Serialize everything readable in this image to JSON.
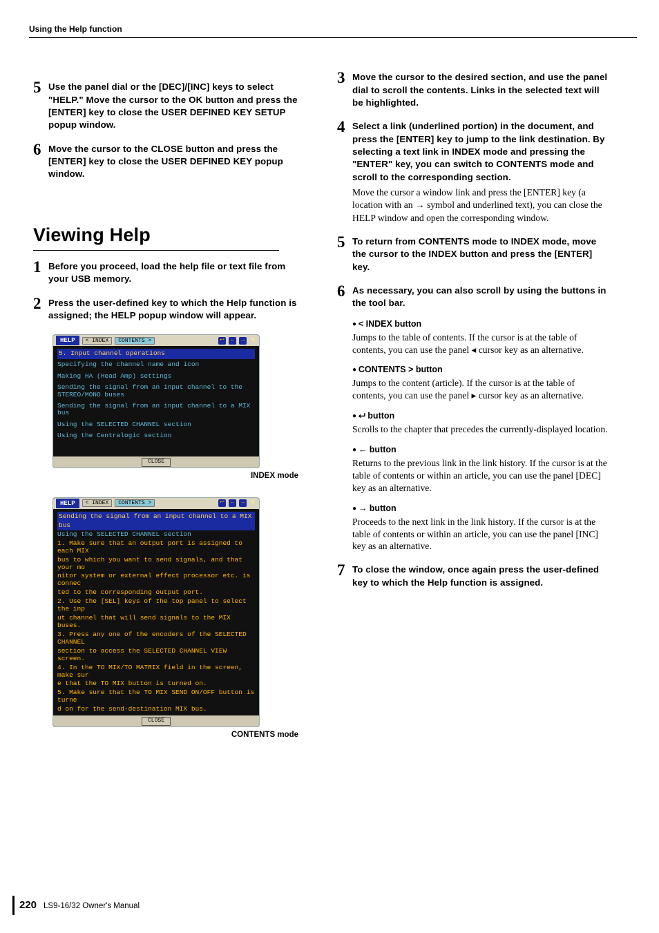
{
  "header": {
    "running": "Using the Help function"
  },
  "left": {
    "step5": "Use the panel dial or the [DEC]/[INC] keys to select \"HELP.\" Move the cursor to the OK button and press the [ENTER] key to close the USER DEFINED KEY SETUP popup window.",
    "step6": "Move the cursor to the CLOSE button and press the [ENTER] key to close the USER DEFINED KEY popup window.",
    "section_title": "Viewing Help",
    "vh1": "Before you proceed, load the help file or text file from your USB memory.",
    "vh2": "Press the user-defined key to which the Help function is assigned; the HELP popup window will appear.",
    "caption1": "INDEX mode",
    "caption2": "CONTENTS mode",
    "ss1": {
      "title": "HELP",
      "btn_index": "< INDEX",
      "btn_contents": "CONTENTS >",
      "hl": "5. Input channel operations",
      "lines": [
        "Specifying the channel name and icon",
        "Making HA (Head Amp) settings",
        "Sending the signal from an input channel to the STEREO/MONO buses",
        "Sending the signal from an input channel to a MIX bus",
        "Using the SELECTED CHANNEL section",
        "Using the Centralogic section"
      ],
      "close": "CLOSE"
    },
    "ss2": {
      "title": "HELP",
      "btn_index": "< INDEX",
      "btn_contents": "CONTENTS >",
      "hl": "Sending the signal from an input channel to a MIX bus",
      "sub": "Using the SELECTED CHANNEL section",
      "body": [
        "  1. Make sure that an output port is assigned to each MIX",
        "   bus to which you want to send signals, and that your mo",
        "nitor system or external effect processor etc. is connec",
        "ted to the corresponding output port.",
        "  2. Use the [SEL] keys of the top panel to select the inp",
        "ut channel that will send signals to the MIX buses.",
        "  3. Press any one of the encoders of the SELECTED CHANNEL",
        "   section to access the SELECTED CHANNEL VIEW screen.",
        "  4. In the TO MIX/TO MATRIX field in the screen, make sur",
        "e that the TO MIX button is turned on.",
        "  5. Make sure that the TO MIX SEND ON/OFF button is turne",
        "d on for the send-destination MIX bus."
      ],
      "close": "CLOSE"
    }
  },
  "right": {
    "step3": "Move the cursor to the desired section, and use the panel dial to scroll the contents. Links in the selected text will be highlighted.",
    "step4": "Select a link (underlined portion) in the document, and press the [ENTER] key to jump to the link destination. By selecting a text link in INDEX mode and pressing the \"ENTER\" key, you can switch to CONTENTS mode and scroll to the corresponding section.",
    "step4_note": "Move the cursor a window link and press the [ENTER] key (a location with an → symbol and underlined text), you can close the HELP window and open the corresponding window.",
    "step5": "To return from CONTENTS mode to INDEX mode, move the cursor to the INDEX button and press the [ENTER] key.",
    "step6": "As necessary, you can also scroll by using the buttons in the tool bar.",
    "bullets": [
      {
        "head": "< INDEX button",
        "body": "Jumps to the table of contents.\nIf the cursor is at the table of contents, you can use the panel ◂ cursor key as an alternative."
      },
      {
        "head": "CONTENTS > button",
        "body": "Jumps to the content (article).\nIf the cursor is at the table of contents, you can use the panel ▸ cursor key as an alternative."
      },
      {
        "head": "⮠  button",
        "body": "Scrolls to the chapter that precedes the currently-displayed location."
      },
      {
        "head": "← button",
        "body": "Returns to the previous link in the link history.\nIf the cursor is at the table of contents or within an article, you can use the panel [DEC] key as an alternative."
      },
      {
        "head": "→ button",
        "body": "Proceeds to the next link in the link history.\nIf the cursor is at the table of contents or within an article, you can use the panel [INC] key as an alternative."
      }
    ],
    "step7": "To close the window, once again press the user-defined key to which the Help function is assigned."
  },
  "footer": {
    "page": "220",
    "text": "LS9-16/32  Owner's Manual"
  }
}
